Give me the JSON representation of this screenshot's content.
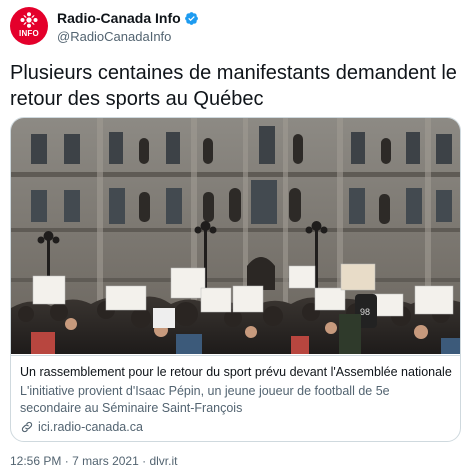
{
  "account": {
    "display_name": "Radio-Canada Info",
    "handle": "@RadioCanadaInfo",
    "avatar_text": "INFO",
    "verified_icon": "verified-badge-icon",
    "brand_color": "#e4002b"
  },
  "tweet": {
    "text": "Plusieurs centaines de manifestants demandent le retour des sports au Québec"
  },
  "card": {
    "image_subject": "protest-crowd-photo",
    "title": "Un rassemblement pour le retour du sport prévu devant l'Assemblée nationale",
    "description": "L'initiative provient d'Isaac Pépin, un jeune joueur de football de 5e secondaire au Séminaire Saint-François",
    "domain": "ici.radio-canada.ca",
    "link_icon": "link-icon"
  },
  "meta": {
    "time": "12:56 PM",
    "separator": "·",
    "date": "7 mars 2021",
    "source": "dlvr.it"
  }
}
